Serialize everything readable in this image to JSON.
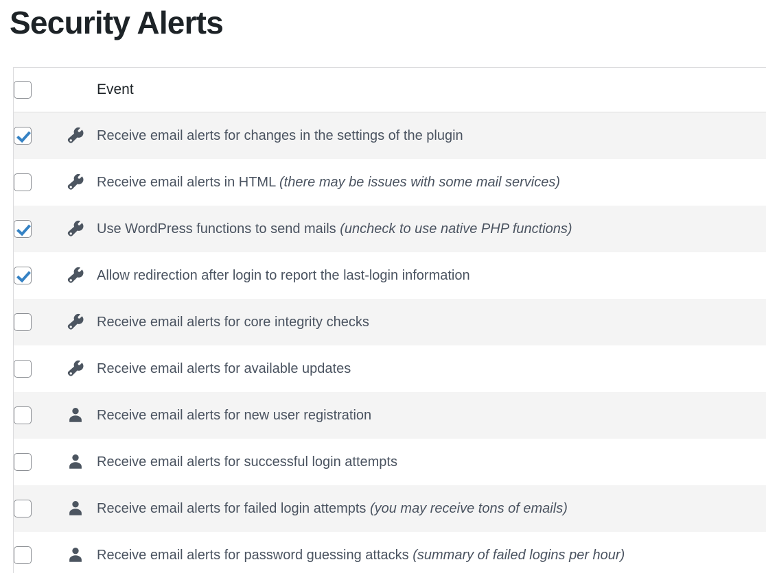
{
  "page": {
    "title": "Security Alerts"
  },
  "table": {
    "header": {
      "select_all_checkbox_checked": false,
      "columns": [
        {
          "key": "event",
          "label": "Event"
        }
      ]
    },
    "rows": [
      {
        "checked": true,
        "icon": "wrench-icon",
        "label": "Receive email alerts for changes in the settings of the plugin",
        "note": ""
      },
      {
        "checked": false,
        "icon": "wrench-icon",
        "label": "Receive email alerts in HTML",
        "note": "(there may be issues with some mail services)"
      },
      {
        "checked": true,
        "icon": "wrench-icon",
        "label": "Use WordPress functions to send mails",
        "note": "(uncheck to use native PHP functions)"
      },
      {
        "checked": true,
        "icon": "wrench-icon",
        "label": "Allow redirection after login to report the last-login information",
        "note": ""
      },
      {
        "checked": false,
        "icon": "wrench-icon",
        "label": "Receive email alerts for core integrity checks",
        "note": ""
      },
      {
        "checked": false,
        "icon": "wrench-icon",
        "label": "Receive email alerts for available updates",
        "note": ""
      },
      {
        "checked": false,
        "icon": "user-icon",
        "label": "Receive email alerts for new user registration",
        "note": ""
      },
      {
        "checked": false,
        "icon": "user-icon",
        "label": "Receive email alerts for successful login attempts",
        "note": ""
      },
      {
        "checked": false,
        "icon": "user-icon",
        "label": "Receive email alerts for failed login attempts",
        "note": "(you may receive tons of emails)"
      },
      {
        "checked": false,
        "icon": "user-icon",
        "label": "Receive email alerts for password guessing attacks",
        "note": "(summary of failed logins per hour)"
      }
    ]
  },
  "colors": {
    "title_text": "#1d2327",
    "body_text": "#4a5360",
    "icon": "#4c5560",
    "checkbox_border": "#8c8f94",
    "checkmark": "#3582c4",
    "row_stripe": "#f4f4f4",
    "row_plain": "#ffffff",
    "table_border": "#dcdcde"
  }
}
